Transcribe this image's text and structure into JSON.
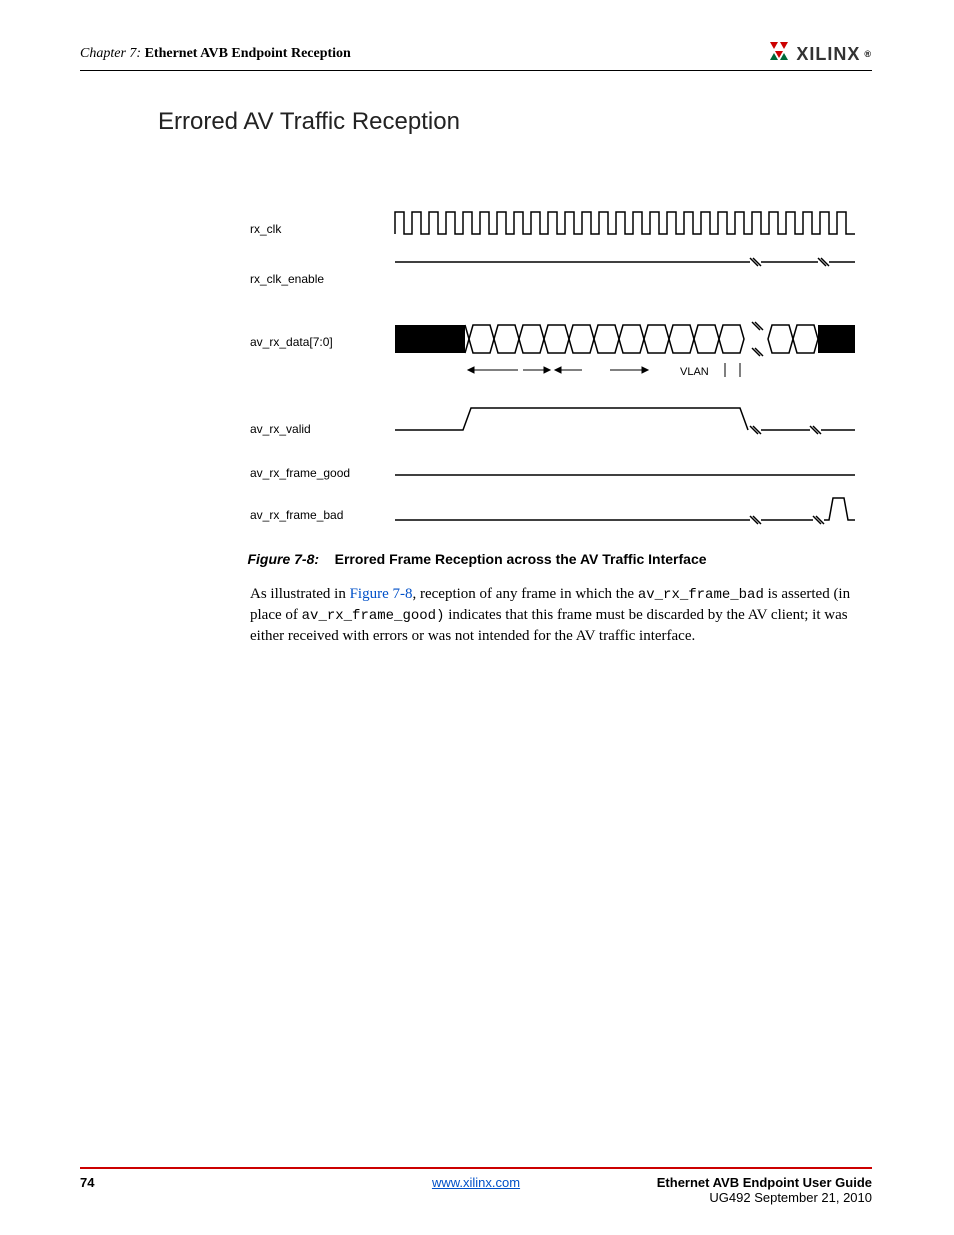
{
  "header": {
    "chapter_prefix": "Chapter 7:",
    "chapter_title": "Ethernet AVB Endpoint Reception",
    "logo_text": "XILINX",
    "logo_r": "®"
  },
  "section_title": "Errored AV Traffic Reception",
  "signals": {
    "s1": "rx_clk",
    "s2": "rx_clk_enable",
    "s3": "av_rx_data[7:0]",
    "s4": "av_rx_valid",
    "s5": "av_rx_frame_good",
    "s6": "av_rx_frame_bad",
    "vlan": "VLAN"
  },
  "figure": {
    "num": "Figure 7-8:",
    "title": "Errored Frame Reception across the AV Traffic Interface"
  },
  "paragraph": {
    "p1a": "As illustrated in ",
    "p1link": "Figure 7-8",
    "p1b": ", reception of any frame in which the ",
    "p1code1": "av_rx_frame_bad",
    "p1c": " is asserted (in place of ",
    "p1code2": "av_rx_frame_good)",
    "p1d": " indicates that this frame must be discarded by the AV client; it was either received with errors or was not intended for the AV traffic interface."
  },
  "footer": {
    "page": "74",
    "url": "www.xilinx.com",
    "guide_title": "Ethernet AVB Endpoint User Guide",
    "doc_id": "UG492 September 21, 2010"
  }
}
